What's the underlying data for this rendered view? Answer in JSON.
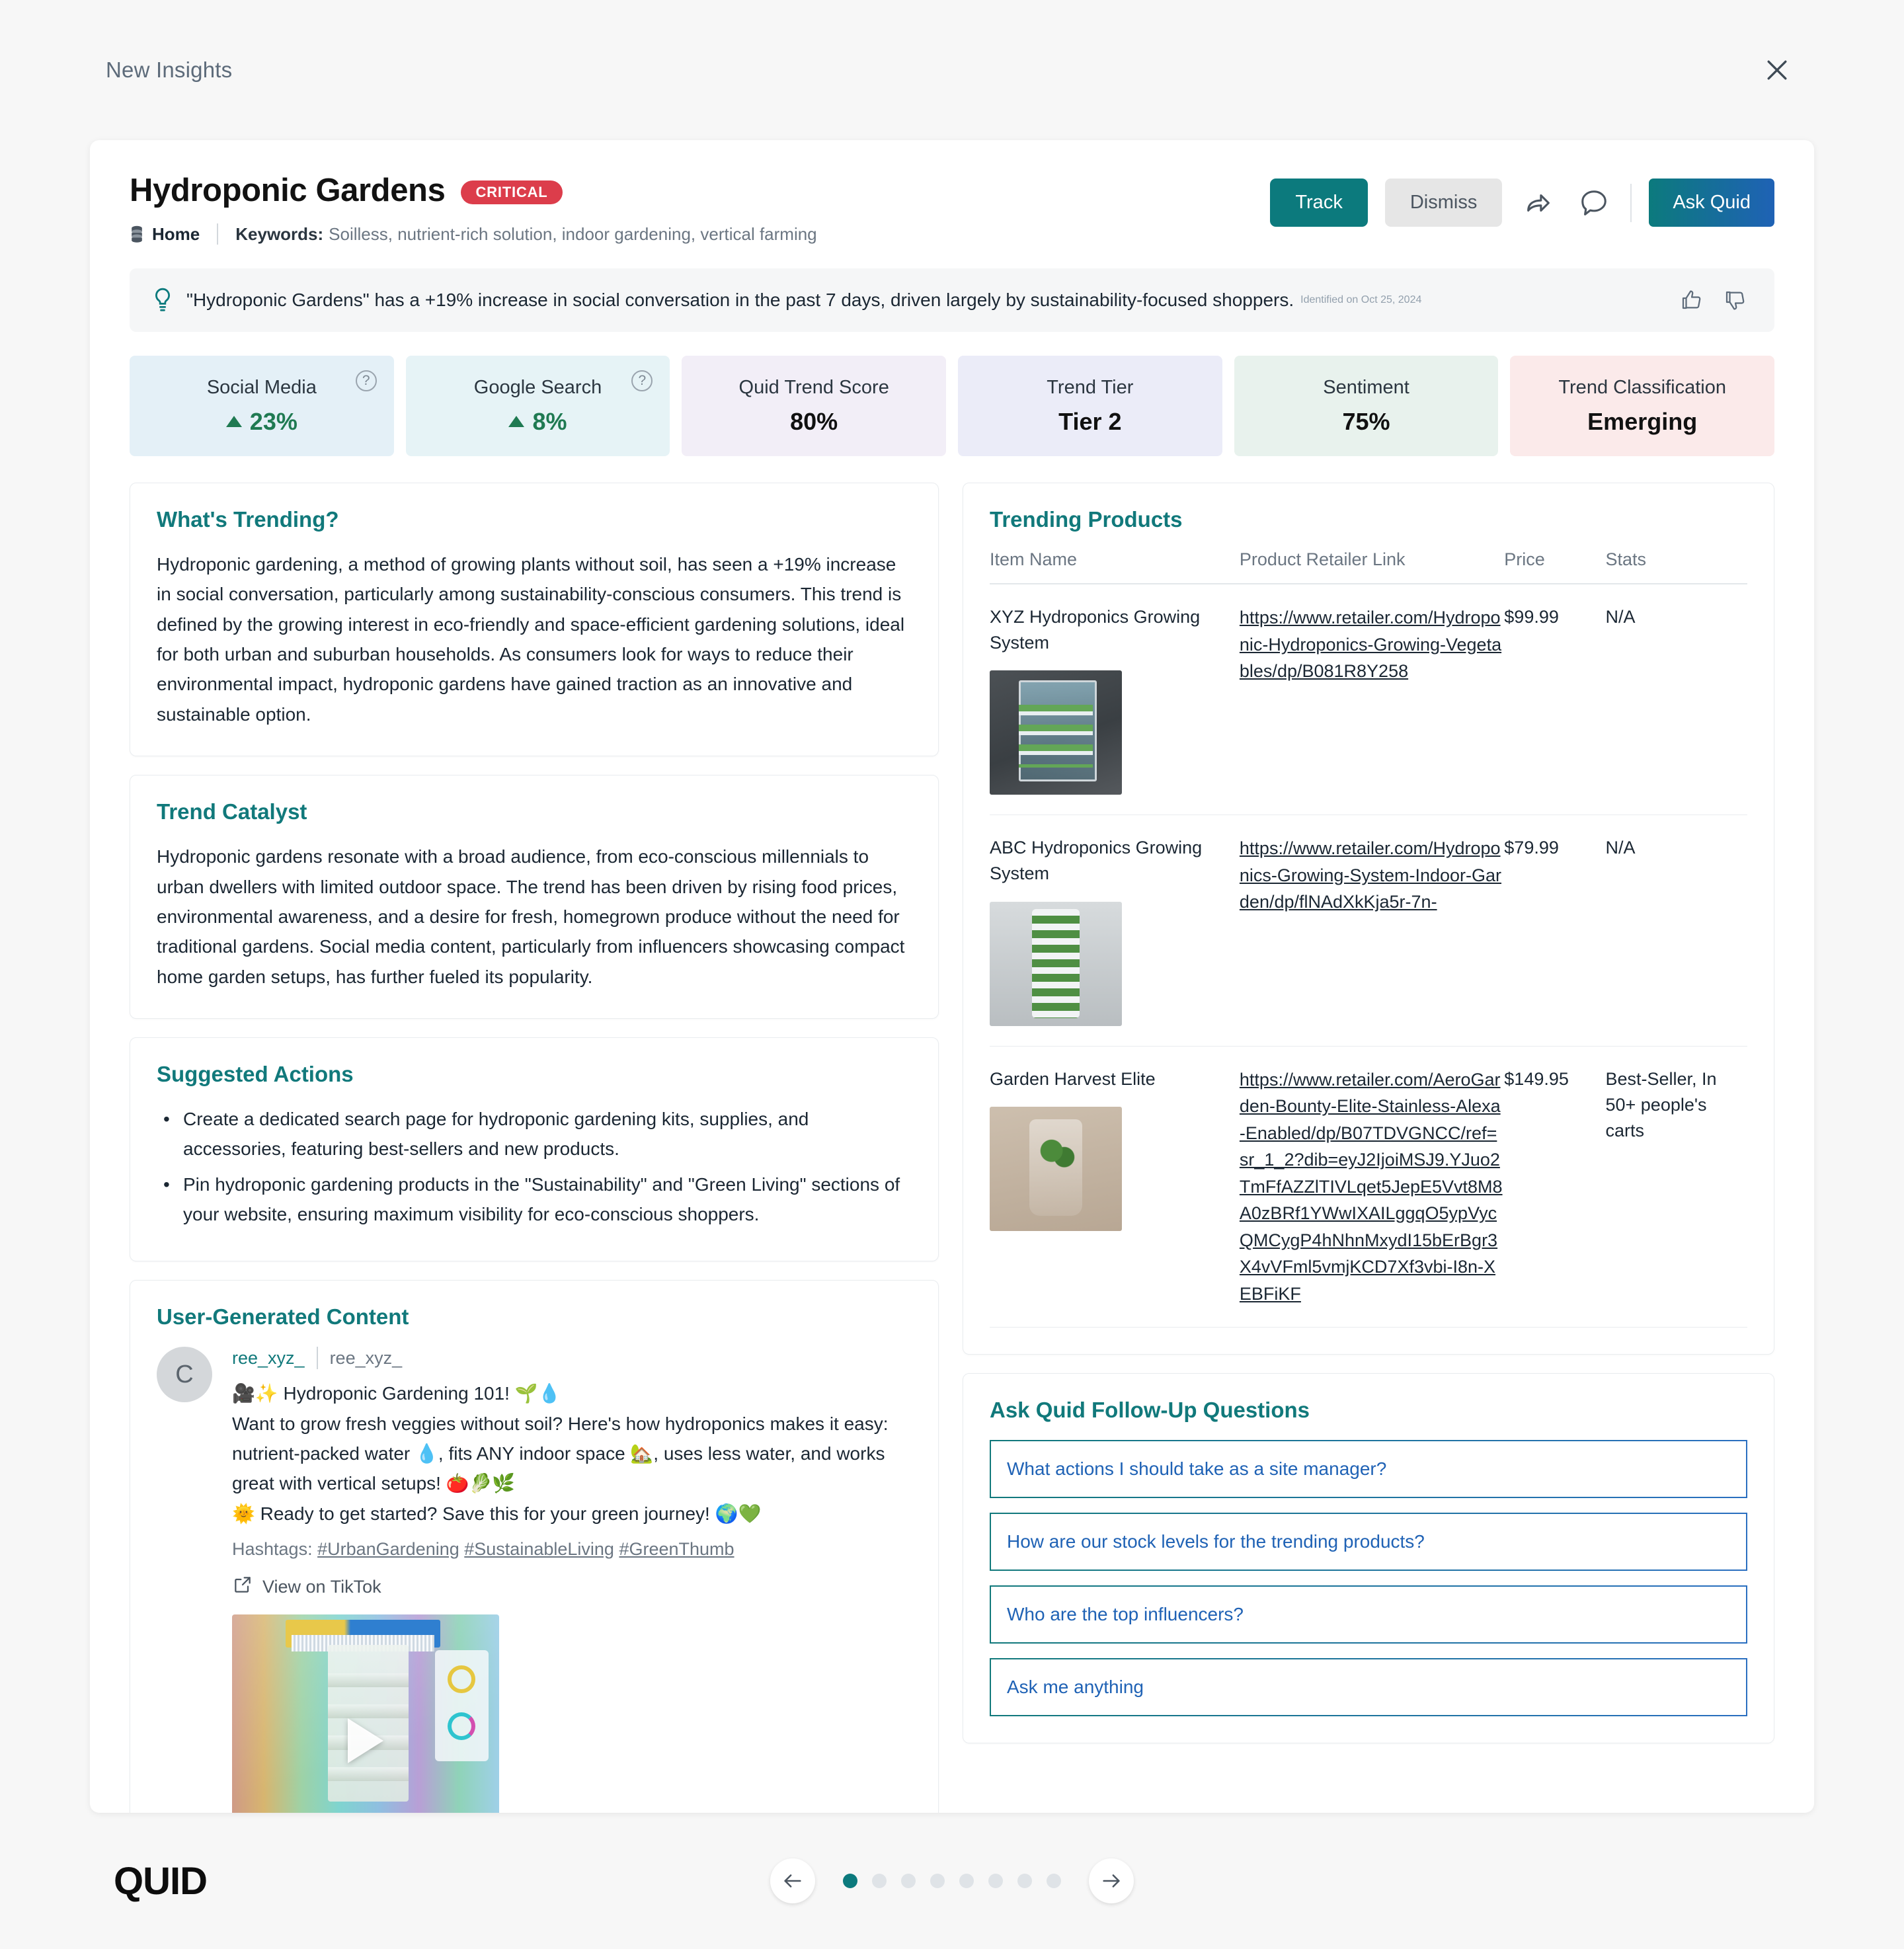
{
  "topbar": {
    "title": "New Insights",
    "close_label": "×"
  },
  "header": {
    "insight_title": "Hydroponic Gardens",
    "badge": "CRITICAL",
    "breadcrumb_home": "Home",
    "keywords_label": "Keywords:",
    "keywords_values": "Soilless, nutrient-rich solution, indoor gardening, vertical farming",
    "track_label": "Track",
    "dismiss_label": "Dismiss",
    "ask_quid_label": "Ask Quid"
  },
  "insight_banner": {
    "text": "\"Hydroponic Gardens\" has a +19% increase in social conversation in the past 7 days, driven largely by sustainability-focused shoppers.",
    "identified_on": "Identified on Oct 25, 2024"
  },
  "metrics": [
    {
      "label": "Social Media",
      "value": "23%",
      "trend": "up",
      "has_help": true,
      "bg": "#e4f0f7"
    },
    {
      "label": "Google Search",
      "value": "8%",
      "trend": "up",
      "has_help": true,
      "bg": "#e6f3f6"
    },
    {
      "label": "Quid Trend Score",
      "value": "80%",
      "trend": "none",
      "has_help": false,
      "bg": "#f2eef7"
    },
    {
      "label": "Trend Tier",
      "value": "Tier 2",
      "trend": "none",
      "has_help": false,
      "bg": "#ebecf8"
    },
    {
      "label": "Sentiment",
      "value": "75%",
      "trend": "none",
      "has_help": false,
      "bg": "#e8f2ed"
    },
    {
      "label": "Trend Classification",
      "value": "Emerging",
      "trend": "none",
      "has_help": false,
      "bg": "#fbeaea"
    }
  ],
  "whats_trending": {
    "title": "What's Trending?",
    "body": "Hydroponic gardening, a method of growing plants without soil, has seen a +19% increase in social conversation, particularly among sustainability-conscious consumers. This trend is defined by the growing interest in eco-friendly and space-efficient gardening solutions, ideal for both urban and suburban households. As consumers look for ways to reduce their environmental impact, hydroponic gardens have gained traction as an innovative and sustainable option."
  },
  "trend_catalyst": {
    "title": "Trend Catalyst",
    "body": "Hydroponic gardens resonate with a broad audience, from eco-conscious millennials to urban dwellers with limited outdoor space. The trend has been driven by rising food prices, environmental awareness, and a desire for fresh, homegrown produce without the need for traditional gardens. Social media content, particularly from influencers showcasing compact home garden setups, has further fueled its popularity."
  },
  "suggested_actions": {
    "title": "Suggested Actions",
    "items": [
      "Create a dedicated search page for hydroponic gardening kits, supplies, and accessories, featuring best-sellers and new products.",
      "Pin hydroponic gardening products in the \"Sustainability\" and \"Green Living\" sections of your website, ensuring maximum visibility for eco-conscious shoppers."
    ]
  },
  "ugc": {
    "title": "User-Generated Content",
    "avatar_initial": "C",
    "handle": "ree_xyz_",
    "display_name": "ree_xyz_",
    "line1": "🎥✨ Hydroponic Gardening 101! 🌱💧",
    "line2": "Want to grow fresh veggies without soil? Here's how hydroponics makes it easy: nutrient-packed water 💧, fits ANY indoor space 🏡, uses less water, and works great with vertical setups! 🍅🥬🌿",
    "line3": "🌞 Ready to get started? Save this for your green journey! 🌍💚",
    "hashtags_label": "Hashtags:",
    "hashtags": [
      "#UrbanGardening",
      "#SustainableLiving",
      "#GreenThumb"
    ],
    "view_link": "View on TikTok"
  },
  "trending_products": {
    "title": "Trending Products",
    "columns": [
      "Item Name",
      "Product Retailer Link",
      "Price",
      "Stats"
    ],
    "rows": [
      {
        "name": "XYZ Hydroponics Growing System",
        "link": "https://www.retailer.com/Hydroponic-Hydroponics-Growing-Vegetables/dp/B081R8Y258",
        "price": "$99.99",
        "stats": "N/A"
      },
      {
        "name": "ABC Hydroponics Growing System",
        "link": "https://www.retailer.com/Hydroponics-Growing-System-Indoor-Garden/dp/flNAdXkKja5r-7n-",
        "price": "$79.99",
        "stats": "N/A"
      },
      {
        "name": "Garden Harvest Elite",
        "link": "https://www.retailer.com/AeroGarden-Bounty-Elite-Stainless-Alexa-Enabled/dp/B07TDVGNCC/ref=sr_1_2?dib=eyJ2IjoiMSJ9.YJuo2TmFfAZZlTIVLqet5JepE5Vvt8M8A0zBRf1YWwIXAILggqO5ypVycQMCygP4hNhnMxydI15bErBgr3X4vVFml5vmjKCD7Xf3vbi-I8n-XEBFiKF",
        "price": "$149.95",
        "stats": "Best-Seller, In 50+ people's carts"
      }
    ]
  },
  "follow_up": {
    "title": "Ask Quid Follow-Up Questions",
    "questions": [
      "What actions I should take as a site manager?",
      "How are our stock levels for the trending products?",
      "Who are the top influencers?",
      "Ask me anything"
    ]
  },
  "footer": {
    "logo": "QUID",
    "total_dots": 8,
    "active_dot": 1
  }
}
